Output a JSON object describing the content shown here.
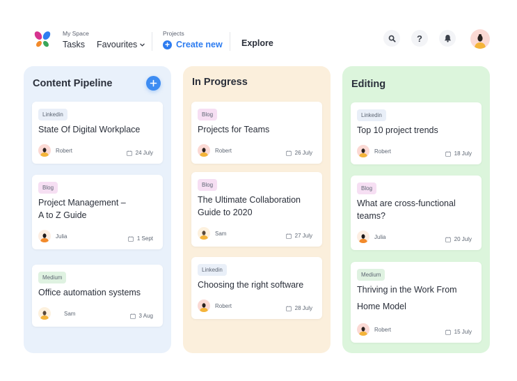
{
  "header": {
    "my_space_caption": "My Space",
    "tasks_label": "Tasks",
    "favourites_label": "Favourites",
    "projects_caption": "Projects",
    "create_new_label": "Create new",
    "explore_label": "Explore",
    "icons": [
      "search-icon",
      "help-icon",
      "bell-icon",
      "user-avatar"
    ]
  },
  "colors": {
    "accent": "#2d7cf0",
    "content_pipeline_bg": "#e9f1fb",
    "in_progress_bg": "#fbefdc",
    "editing_bg": "#dcf5dc",
    "tag_linkedin": "#e9eff8",
    "tag_blog": "#f6dff3",
    "tag_medium": "#dff2e1"
  },
  "columns": [
    {
      "title": "Content Pipeline",
      "has_add_button": true,
      "cards": [
        {
          "tag": "Linkedin",
          "title_lines": [
            "State Of Digital Workplace"
          ],
          "author": "Robert",
          "date": "24 July"
        },
        {
          "tag": "Blog",
          "title_lines": [
            "Project Management –",
            "A to Z Guide"
          ],
          "author": "Julia",
          "date": "1 Sept"
        },
        {
          "tag": "Medium",
          "title_lines": [
            "Office automation systems"
          ],
          "author": "Sam",
          "date": "3 Aug"
        }
      ]
    },
    {
      "title": "In Progress",
      "has_add_button": false,
      "cards": [
        {
          "tag": "Blog",
          "title_lines": [
            "Projects for Teams"
          ],
          "author": "Robert",
          "date": "26 July"
        },
        {
          "tag": "Blog",
          "title_lines": [
            "The Ultimate Collaboration",
            "Guide to 2020"
          ],
          "author": "Sam",
          "date": "27 July"
        },
        {
          "tag": "Linkedin",
          "title_lines": [
            "Choosing the right software"
          ],
          "author": "Robert",
          "date": "28 July"
        }
      ]
    },
    {
      "title": "Editing",
      "has_add_button": false,
      "cards": [
        {
          "tag": "Linkedin",
          "title_lines": [
            "Top 10 project trends"
          ],
          "author": "Robert",
          "date": "18 July"
        },
        {
          "tag": "Blog",
          "title_lines": [
            "What are cross-functional",
            "teams?"
          ],
          "author": "Julia",
          "date": "20 July"
        },
        {
          "tag": "Medium",
          "title_lines": [
            "Thriving in the Work From",
            "Home Model"
          ],
          "author": "Robert",
          "date": "15 July"
        }
      ]
    }
  ]
}
